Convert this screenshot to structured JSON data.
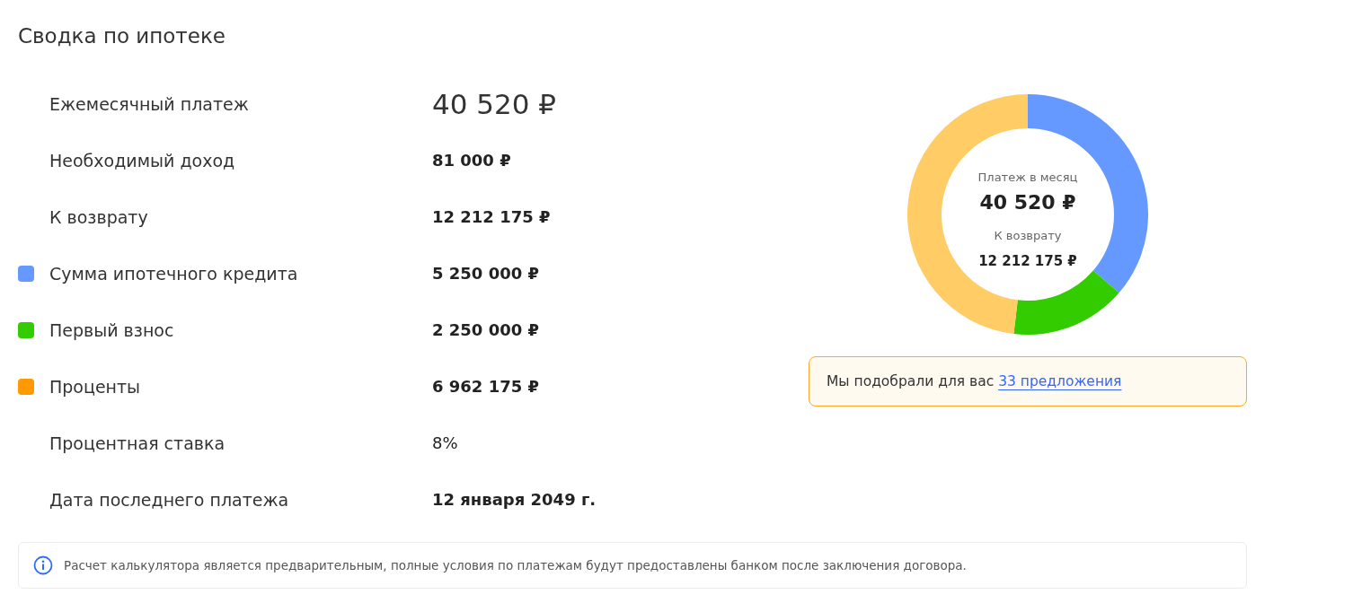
{
  "title": "Сводка по ипотеке",
  "rows": [
    {
      "kind": "headline",
      "label": "Ежемесячный платеж",
      "value": "40 520 ₽"
    },
    {
      "kind": "amount",
      "label": "Необходимый доход",
      "value": "81 000 ₽"
    },
    {
      "kind": "amount",
      "label": "К возврату",
      "value": "12 212 175 ₽"
    },
    {
      "kind": "amount",
      "label": "Сумма ипотечного кредита",
      "value": "5 250 000 ₽",
      "color": "#6699ff"
    },
    {
      "kind": "amount",
      "label": "Первый взнос",
      "value": "2 250 000 ₽",
      "color": "#33cc00"
    },
    {
      "kind": "amount",
      "label": "Проценты",
      "value": "6 962 175 ₽",
      "color": "#ff9900"
    },
    {
      "kind": "plain",
      "label": "Процентная ставка",
      "value": "8%"
    },
    {
      "kind": "amount",
      "label": "Дата последнего платежа",
      "value": "12 января 2049 г."
    }
  ],
  "donut": {
    "caption": "Платеж в месяц",
    "amount": "40 520 ₽",
    "caption_2": "К возврату",
    "amount_2": "12 212 175 ₽",
    "chart_data": {
      "type": "donut",
      "colors": [
        "#6699ff",
        "#33cc00",
        "#ffcc66"
      ],
      "series": [
        {
          "values": [
            36.3,
            15.56,
            48.14
          ]
        }
      ]
    }
  },
  "offer": {
    "text": "Мы подобрали для вас",
    "link": "33 предложения"
  },
  "disclaimer": {
    "text": "Расчет калькулятора является предварительным, полные условия по платежам будут предоставлены банком после заключения договора."
  }
}
